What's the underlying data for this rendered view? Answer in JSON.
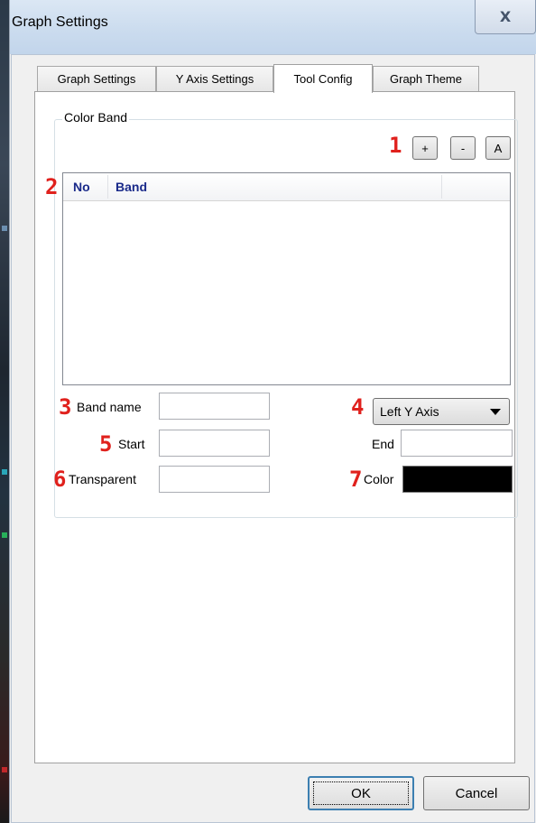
{
  "window": {
    "title": "Graph Settings",
    "close_glyph": "X"
  },
  "tabs": [
    {
      "label": "Graph Settings",
      "active": false
    },
    {
      "label": "Y Axis Settings",
      "active": false
    },
    {
      "label": "Tool Config",
      "active": true
    },
    {
      "label": "Graph Theme",
      "active": false
    }
  ],
  "color_band": {
    "group_label": "Color Band",
    "buttons": {
      "add": "+",
      "remove": "-",
      "all": "A"
    },
    "columns": [
      "No",
      "Band"
    ],
    "rows": [],
    "band_name_label": "Band name",
    "band_name_value": "",
    "axis_select": "Left Y Axis",
    "start_label": "Start",
    "start_value": "",
    "end_label": "End",
    "end_value": "",
    "transparent_label": "Transparent",
    "transparent_value": "",
    "color_label": "Color",
    "color_value": "#000000"
  },
  "annotations": [
    "1",
    "2",
    "3",
    "4",
    "5",
    "6",
    "7"
  ],
  "footer": {
    "ok": "OK",
    "cancel": "Cancel"
  },
  "colors": {
    "annotation": "#e0211d",
    "column_header": "#1a2a8a",
    "title_bar": "#cadbee"
  }
}
